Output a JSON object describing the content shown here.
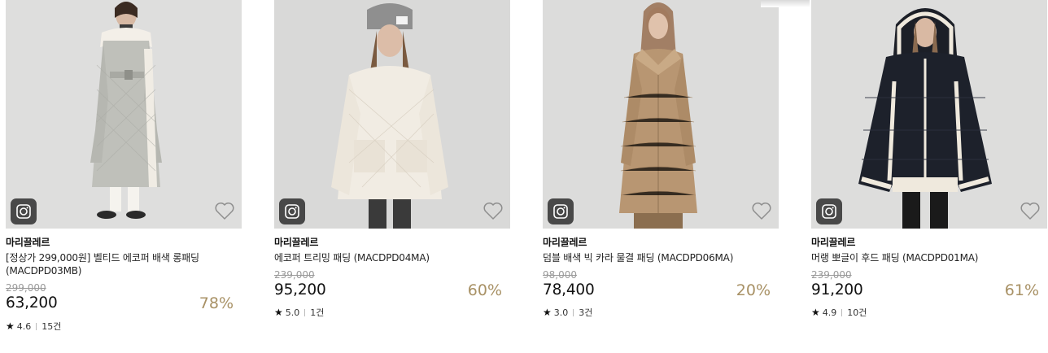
{
  "products": [
    {
      "brand": "마리끌레르",
      "name": "[정상가 299,000원] 벨티드 에코퍼 배색 롱패딩 (MACDPD03MB)",
      "original_price": "299,000",
      "price": "63,200",
      "discount": "78%",
      "rating": "4.6",
      "reviews": "15건",
      "image_desc": "light grey quilted long coat"
    },
    {
      "brand": "마리끌레르",
      "name": "에코퍼 트리밍 패딩 (MACDPD04MA)",
      "original_price": "239,000",
      "price": "95,200",
      "discount": "60%",
      "rating": "5.0",
      "reviews": "1건",
      "image_desc": "cream short quilted jacket"
    },
    {
      "brand": "마리끌레르",
      "name": "덤블 배색 빅 카라 물결 패딩 (MACDPD06MA)",
      "original_price": "98,000",
      "price": "78,400",
      "discount": "20%",
      "rating": "3.0",
      "reviews": "3건",
      "image_desc": "camel long quilted coat"
    },
    {
      "brand": "마리끌레르",
      "name": "머랭 뽀글이 후드 패딩 (MACDPD01MA)",
      "original_price": "239,000",
      "price": "91,200",
      "discount": "61%",
      "rating": "4.9",
      "reviews": "10건",
      "image_desc": "black hooded puffer with white trim"
    }
  ],
  "icons": {
    "instagram": "instagram-icon",
    "wishlist": "heart-outline-icon",
    "star": "star-icon"
  },
  "colors": {
    "discount": "#a89165",
    "original_price": "#9a9a9a",
    "thumb_bg": "#dcdcdb"
  }
}
